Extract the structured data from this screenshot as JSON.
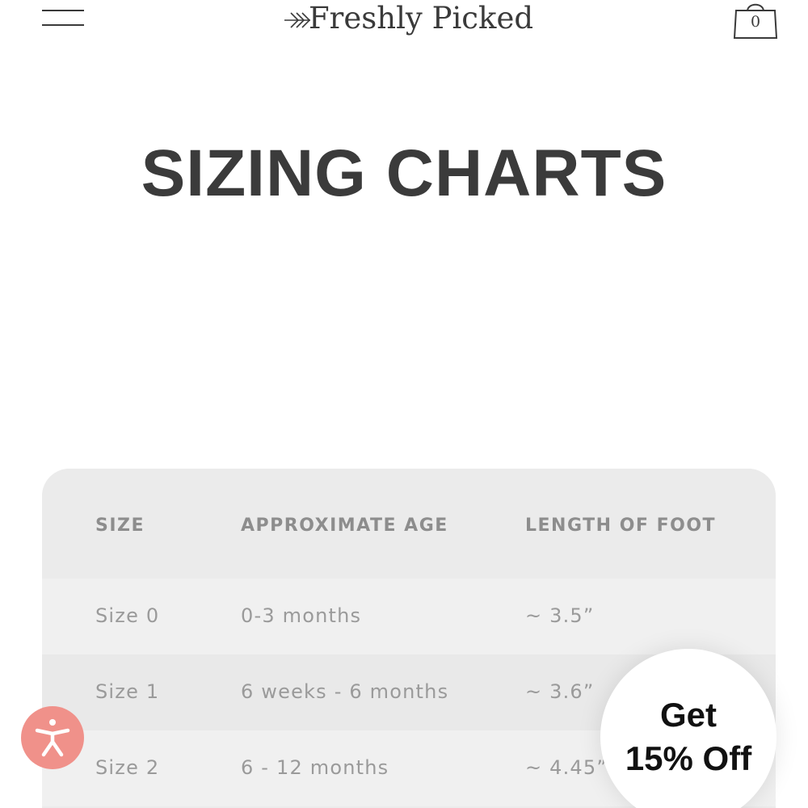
{
  "header": {
    "brand": "Freshly Picked",
    "cart_count": "0"
  },
  "page": {
    "title": "SIZING CHARTS"
  },
  "table": {
    "headers": [
      "SIZE",
      "APPROXIMATE AGE",
      "LENGTH OF FOOT"
    ],
    "rows": [
      {
        "size": "Size 0",
        "age": "0-3 months",
        "foot": "~ 3.5”"
      },
      {
        "size": "Size 1",
        "age": "6 weeks - 6 months",
        "foot": "~ 3.6”"
      },
      {
        "size": "Size 2",
        "age": "6 - 12 months",
        "foot": "~ 4.45”"
      }
    ]
  },
  "promo": {
    "line1": "Get",
    "line2": "15% Off"
  },
  "icons": {
    "menu": "hamburger-menu-icon",
    "logo_arrow": "double-arrow-icon",
    "cart": "shopping-bag-icon",
    "accessibility": "accessibility-person-icon"
  },
  "colors": {
    "text": "#3a3a3a",
    "table_bg": "#ebebeb",
    "header_text": "#8d8d8d",
    "cell_text": "#9a9a9a",
    "accessibility": "#f0918a"
  }
}
